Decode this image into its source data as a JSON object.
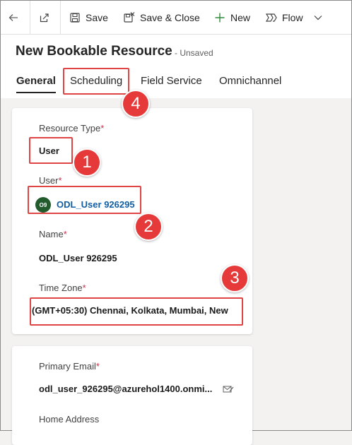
{
  "toolbar": {
    "save_label": "Save",
    "save_close_label": "Save & Close",
    "new_label": "New",
    "flow_label": "Flow"
  },
  "header": {
    "title": "New Bookable Resource",
    "status": "- Unsaved"
  },
  "tabs": [
    {
      "label": "General",
      "selected": true
    },
    {
      "label": "Scheduling"
    },
    {
      "label": "Field Service"
    },
    {
      "label": "Omnichannel"
    }
  ],
  "form": {
    "resource_type": {
      "label": "Resource Type",
      "required_mark": "*",
      "value": "User"
    },
    "user": {
      "label": "User",
      "required_mark": "*",
      "avatar_initials": "O9",
      "value": "ODL_User 926295"
    },
    "name": {
      "label": "Name",
      "required_mark": "*",
      "value": "ODL_User 926295"
    },
    "time_zone": {
      "label": "Time Zone",
      "required_mark": "*",
      "value": "(GMT+05:30) Chennai, Kolkata, Mumbai, New"
    }
  },
  "form2": {
    "primary_email": {
      "label": "Primary Email",
      "required_mark": "*",
      "value": "odl_user_926295@azurehol1400.onmi..."
    },
    "home_address": {
      "label": "Home Address"
    }
  },
  "annotations": {
    "badge_1": "1",
    "badge_2": "2",
    "badge_3": "3",
    "badge_4": "4"
  },
  "colors": {
    "accent_link": "#115ea3",
    "required": "#c4314b",
    "annotation_red": "#e04545",
    "avatar_bg": "#225c2c"
  }
}
